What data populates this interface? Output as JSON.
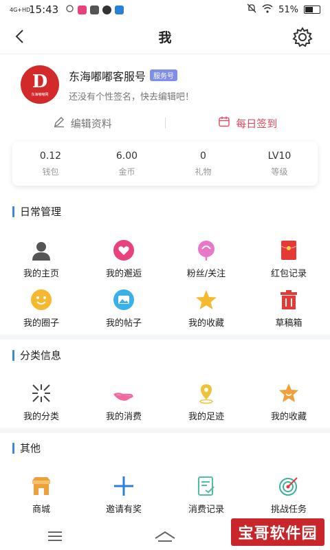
{
  "status_bar": {
    "network": "4G+HD",
    "time": "15:43",
    "battery": "51%",
    "app_icons": [
      "refresh-icon",
      "heart-app-icon",
      "wechat-icon",
      "compass-icon",
      "blue-app-icon"
    ],
    "right_icons": [
      "mute-icon",
      "wifi-icon",
      "battery-icon"
    ]
  },
  "header": {
    "title": "我",
    "back_icon": "back-arrow-icon",
    "settings_icon": "gear-icon"
  },
  "profile": {
    "name": "东海嘟嘟客服号",
    "badge": "服务号",
    "signature": "还没有个性签名，快去编辑吧！",
    "avatar_letter": "D",
    "avatar_subtitle": "东海嘟嘟网"
  },
  "actions": {
    "edit": "编辑资料",
    "checkin": "每日签到"
  },
  "stats": [
    {
      "value": "0.12",
      "label": "钱包"
    },
    {
      "value": "6.00",
      "label": "金币"
    },
    {
      "value": "0",
      "label": "礼物"
    },
    {
      "value": "LV10",
      "label": "等级"
    }
  ],
  "daily": {
    "title": "日常管理",
    "row1": [
      {
        "label": "我的主页",
        "icon": "user-icon",
        "color": "#555555"
      },
      {
        "label": "我的邂逅",
        "icon": "heart-icon",
        "color": "#e8427c"
      },
      {
        "label": "粉丝/关注",
        "icon": "lollipop-icon",
        "color": "#e877c8"
      },
      {
        "label": "红包记录",
        "icon": "red-envelope-icon",
        "color": "#e53935"
      }
    ],
    "row2": [
      {
        "label": "我的圈子",
        "icon": "smile-icon",
        "color": "#f5b82e"
      },
      {
        "label": "我的帖子",
        "icon": "picture-icon",
        "color": "#3ab0e8"
      },
      {
        "label": "我的收藏",
        "icon": "star-icon",
        "color": "#f5b82e"
      },
      {
        "label": "草稿箱",
        "icon": "trash-icon",
        "color": "#e53935"
      }
    ]
  },
  "category": {
    "title": "分类信息",
    "items": [
      {
        "label": "我的分类",
        "icon": "category-icon",
        "color": "#444444"
      },
      {
        "label": "我的消费",
        "icon": "hand-icon",
        "color": "#f06aa0"
      },
      {
        "label": "我的足迹",
        "icon": "location-pin-icon",
        "color": "#f0c23a"
      },
      {
        "label": "我的收藏",
        "icon": "star-smile-icon",
        "color": "#f0a03a"
      }
    ]
  },
  "other": {
    "title": "其他",
    "items": [
      {
        "label": "商城",
        "icon": "shop-icon",
        "color": "#f0a03a"
      },
      {
        "label": "邀请有奖",
        "icon": "plus-icon",
        "color": "#2a7fd6"
      },
      {
        "label": "消费记录",
        "icon": "record-icon",
        "color": "#4fbfa0"
      },
      {
        "label": "挑战任务",
        "icon": "target-icon",
        "color": "#3ab0a0"
      }
    ]
  },
  "bottom_nav": [
    "menu-icon",
    "home-icon",
    "back-icon"
  ],
  "watermark": "宝哥软件园"
}
